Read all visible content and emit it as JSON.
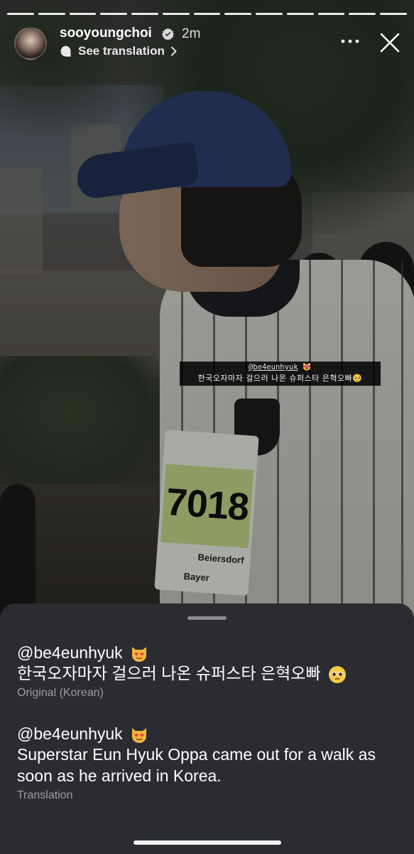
{
  "story": {
    "username": "sooyoungchoi",
    "time": "2m",
    "see_translation": "See translation",
    "progress_total": 13,
    "progress_current": 13
  },
  "sticker": {
    "mention": "@be4eunhyuk",
    "text": "한국오자마자 걸으러 나온 슈퍼스타 은혁오빠"
  },
  "photo": {
    "bib_number": "7018",
    "bib_sponsor_1": "Beiersdorf",
    "bib_sponsor_2": "Bayer"
  },
  "translation_sheet": {
    "original": {
      "mention": "@be4eunhyuk",
      "text": "한국오자마자 걸으러 나온 슈퍼스타 은혁오빠",
      "label": "Original (Korean)"
    },
    "translated": {
      "mention": "@be4eunhyuk",
      "text": "Superstar Eun Hyuk Oppa came out for a walk as soon as he arrived in Korea.",
      "label": "Translation"
    }
  },
  "colors": {
    "sheet_bg": "#2a2c31",
    "sub_label": "#9a9ca0"
  },
  "icons": [
    "verified-badge-icon",
    "translate-icon",
    "chevron-right-icon",
    "more-icon",
    "close-icon",
    "heart-eyes-cat-emoji",
    "pleading-face-emoji"
  ]
}
